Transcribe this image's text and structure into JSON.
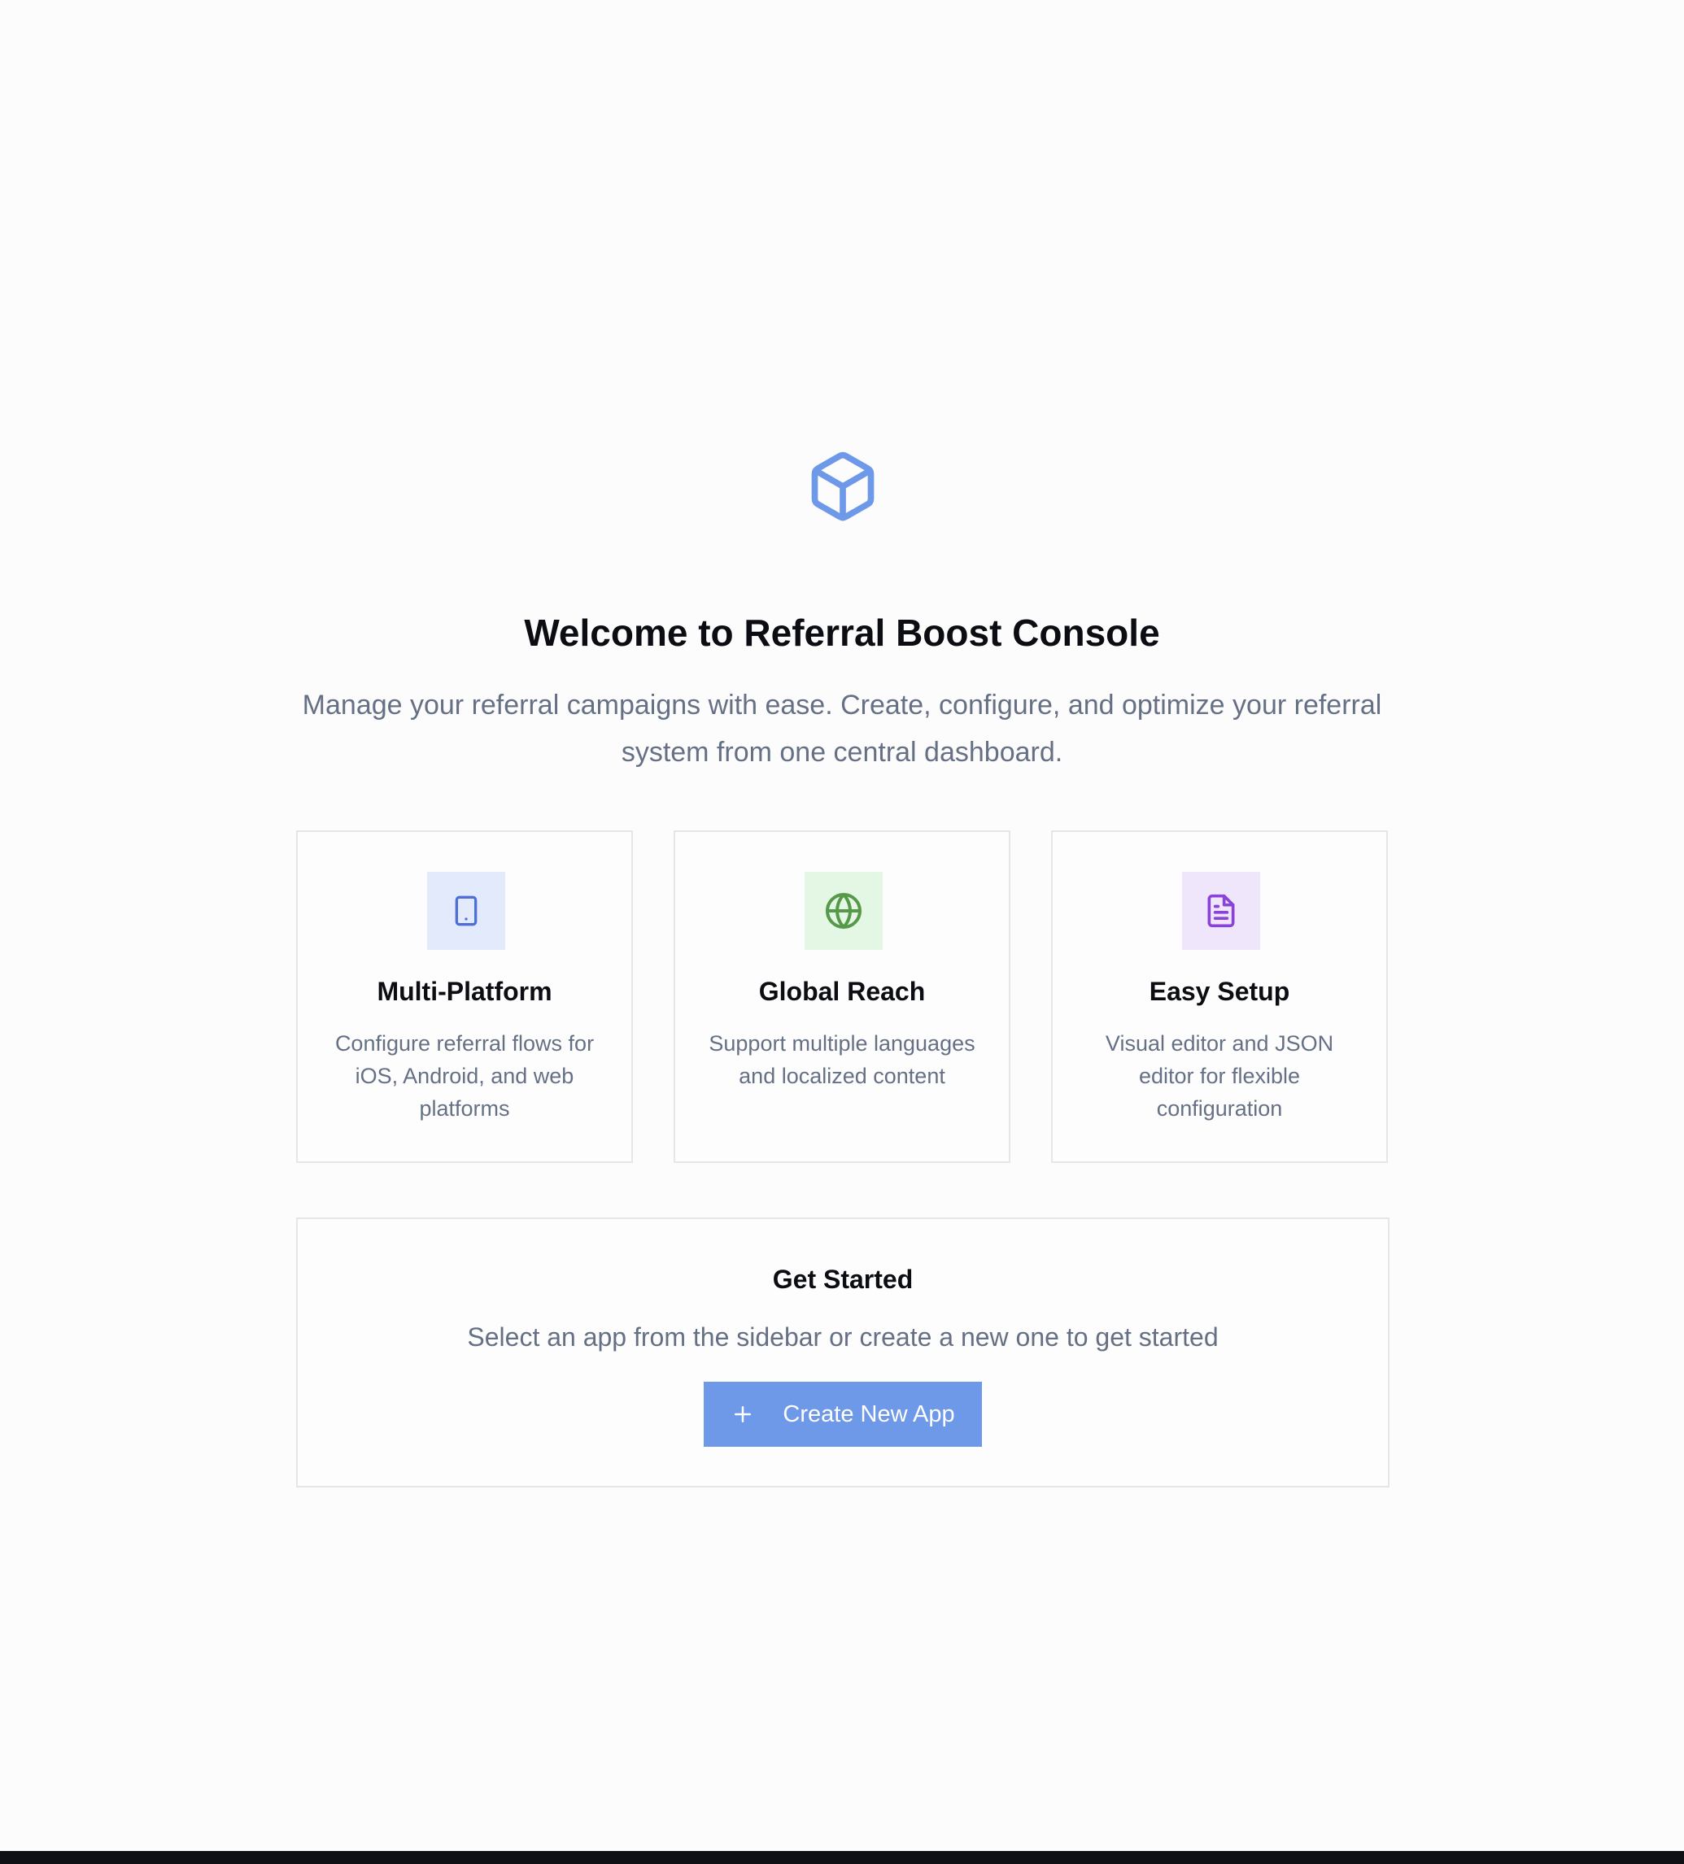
{
  "welcome": {
    "logo_icon": "package-icon",
    "title": "Welcome to Referral Boost Console",
    "subtitle": "Manage your referral campaigns with ease. Create, configure, and optimize your referral system from one central dashboard."
  },
  "features": [
    {
      "icon": "tablet-icon",
      "icon_color": "#4f6fd8",
      "icon_bg": "#e3eafb",
      "title": "Multi-Platform",
      "description": "Configure referral flows for iOS, Android, and web platforms"
    },
    {
      "icon": "globe-icon",
      "icon_color": "#57994a",
      "icon_bg": "#e4f6e4",
      "title": "Global Reach",
      "description": "Support multiple languages and localized content"
    },
    {
      "icon": "file-text-icon",
      "icon_color": "#8a43d8",
      "icon_bg": "#efe6fb",
      "title": "Easy Setup",
      "description": "Visual editor and JSON editor for flexible configuration"
    }
  ],
  "get_started": {
    "title": "Get Started",
    "description": "Select an app from the sidebar or create a new one to get started",
    "button_label": "Create New App",
    "button_icon": "plus-icon",
    "button_color": "#6e98e8"
  },
  "colors": {
    "accent": "#6e98e8",
    "heading": "#0b0d12",
    "muted_text": "#667085",
    "border": "#e4e6ea"
  }
}
